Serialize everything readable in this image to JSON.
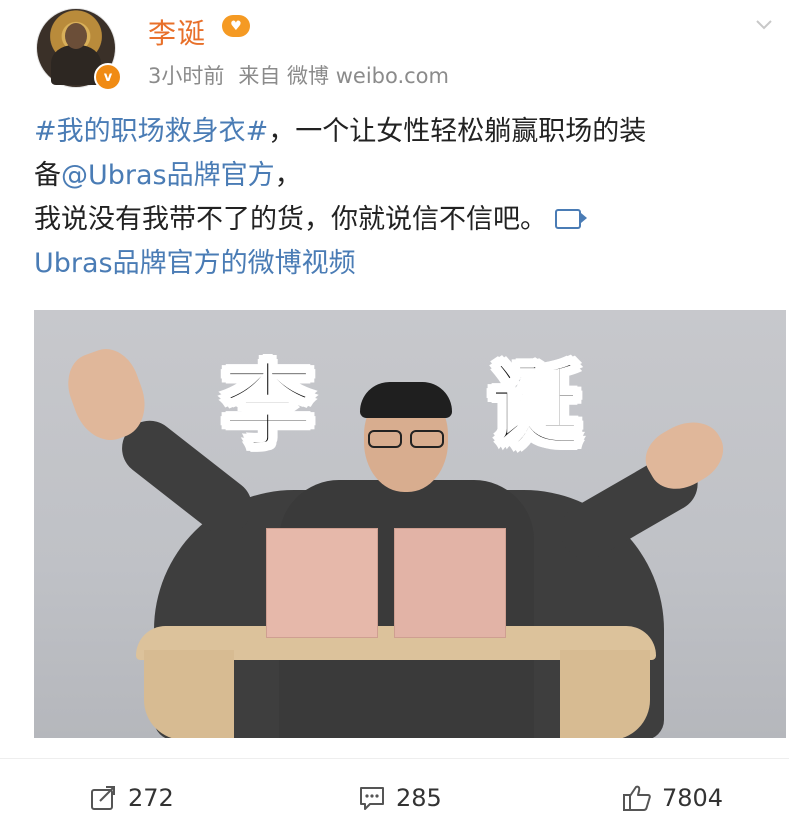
{
  "header": {
    "username": "李诞",
    "time": "3小时前",
    "source": "来自 微博 weibo.com"
  },
  "post": {
    "hashtag": "#我的职场救身衣#",
    "line1_rest": "，一个让女性轻松躺赢职场的装",
    "line2_prefix": "备",
    "mention": "@Ubras品牌官方",
    "line2_suffix": "，",
    "line3": "我说没有我带不了的货，你就说信不信吧。",
    "video_link": "Ubras品牌官方的微博视频"
  },
  "video": {
    "overlay_left": "李",
    "overlay_right": "诞"
  },
  "actions": {
    "repost_count": "272",
    "comment_count": "285",
    "like_count": "7804"
  },
  "colors": {
    "username": "#e8702a",
    "link": "#4a7cb5",
    "meta": "#8b8b8b"
  }
}
